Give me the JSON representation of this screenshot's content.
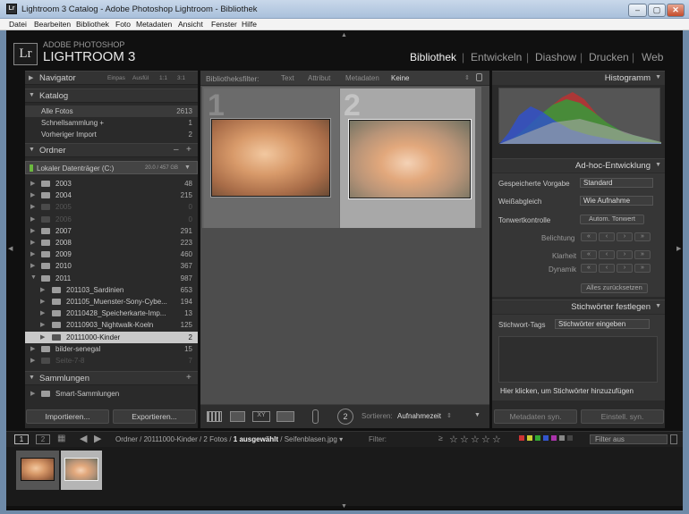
{
  "window": {
    "title": "Lightroom 3 Catalog - Adobe Photoshop Lightroom - Bibliothek",
    "minimize": "–",
    "maximize": "▢",
    "close": "✕"
  },
  "menu": [
    "Datei",
    "Bearbeiten",
    "Bibliothek",
    "Foto",
    "Metadaten",
    "Ansicht",
    "Fenster",
    "Hilfe"
  ],
  "brand": {
    "badge": "Lr",
    "small": "ADOBE PHOTOSHOP",
    "big": "LIGHTROOM 3"
  },
  "modules": [
    "Bibliothek",
    "Entwickeln",
    "Diashow",
    "Drucken",
    "Web"
  ],
  "navigator": {
    "title": "Navigator",
    "options": [
      "Einpas",
      "Ausfül",
      "1:1",
      "3:1"
    ]
  },
  "katalog": {
    "title": "Katalog",
    "items": [
      {
        "label": "Alle Fotos",
        "count": "2613"
      },
      {
        "label": "Schnellsammlung +",
        "count": "1"
      },
      {
        "label": "Vorheriger Import",
        "count": "2"
      }
    ]
  },
  "ordner": {
    "title": "Ordner",
    "drive": "Lokaler Datenträger (C:)",
    "drive_size": "20.0 / 457 GB",
    "folders": [
      {
        "label": "2003",
        "count": "48",
        "dim": false
      },
      {
        "label": "2004",
        "count": "215",
        "dim": false
      },
      {
        "label": "2005",
        "count": "0",
        "dim": true
      },
      {
        "label": "2006",
        "count": "0",
        "dim": true
      },
      {
        "label": "2007",
        "count": "291",
        "dim": false
      },
      {
        "label": "2008",
        "count": "223",
        "dim": false
      },
      {
        "label": "2009",
        "count": "460",
        "dim": false
      },
      {
        "label": "2010",
        "count": "367",
        "dim": false
      },
      {
        "label": "2011",
        "count": "987",
        "dim": false
      }
    ],
    "sub": [
      {
        "label": "201103_Sardinien",
        "count": "653"
      },
      {
        "label": "201105_Muenster-Sony-Cybe...",
        "count": "194"
      },
      {
        "label": "20110428_Speicherkarte-Imp...",
        "count": "13"
      },
      {
        "label": "20110903_Nightwalk-Koeln",
        "count": "125"
      },
      {
        "label": "20111000-Kinder",
        "count": "2"
      }
    ],
    "after": [
      {
        "label": "bilder-senegal",
        "count": "15"
      },
      {
        "label": "Seite-7-8",
        "count": "7"
      }
    ]
  },
  "sammlungen": {
    "title": "Sammlungen",
    "smart": "Smart-Sammlungen"
  },
  "buttons": {
    "import": "Importieren...",
    "export": "Exportieren...",
    "sync_meta": "Metadaten syn.",
    "sync_settings": "Einstell. syn."
  },
  "filter": {
    "label": "Bibliotheksfilter:",
    "tabs": [
      "Text",
      "Attribut",
      "Metadaten",
      "Keine"
    ]
  },
  "grid": {
    "cells": [
      "1",
      "2"
    ]
  },
  "toolbar": {
    "sort_label": "Sortieren:",
    "sort_value": "Aufnahmezeit"
  },
  "histogram": {
    "title": "Histogramm"
  },
  "adhoc": {
    "title": "Ad-hoc-Entwicklung",
    "preset_label": "Gespeicherte Vorgabe",
    "preset_value": "Standard",
    "wb_label": "Weißabgleich",
    "wb_value": "Wie Aufnahme",
    "tone_label": "Tonwertkontrolle",
    "tone_btn": "Autom. Tonwert",
    "exposure": "Belichtung",
    "clarity": "Klarheit",
    "vibrance": "Dynamik",
    "reset": "Alles zurücksetzen"
  },
  "keywords": {
    "title": "Stichwörter festlegen",
    "tags_label": "Stichwort-Tags",
    "tags_value": "Stichwörter eingeben",
    "hint": "Hier klicken, um Stichwörter hinzuzufügen"
  },
  "filmbar": {
    "page1": "1",
    "page2": "2",
    "path_prefix": "Ordner / 20111000-Kinder / 2 Fotos / ",
    "selected": "1 ausgewählt",
    "path_suffix": " / Seifenblasen.jpg",
    "filter_label": "Filter:",
    "filter_value": "Filter aus"
  },
  "colors": {
    "bg": "#101010",
    "panel": "#2a2a2a",
    "accent": "#f2f2f2"
  }
}
